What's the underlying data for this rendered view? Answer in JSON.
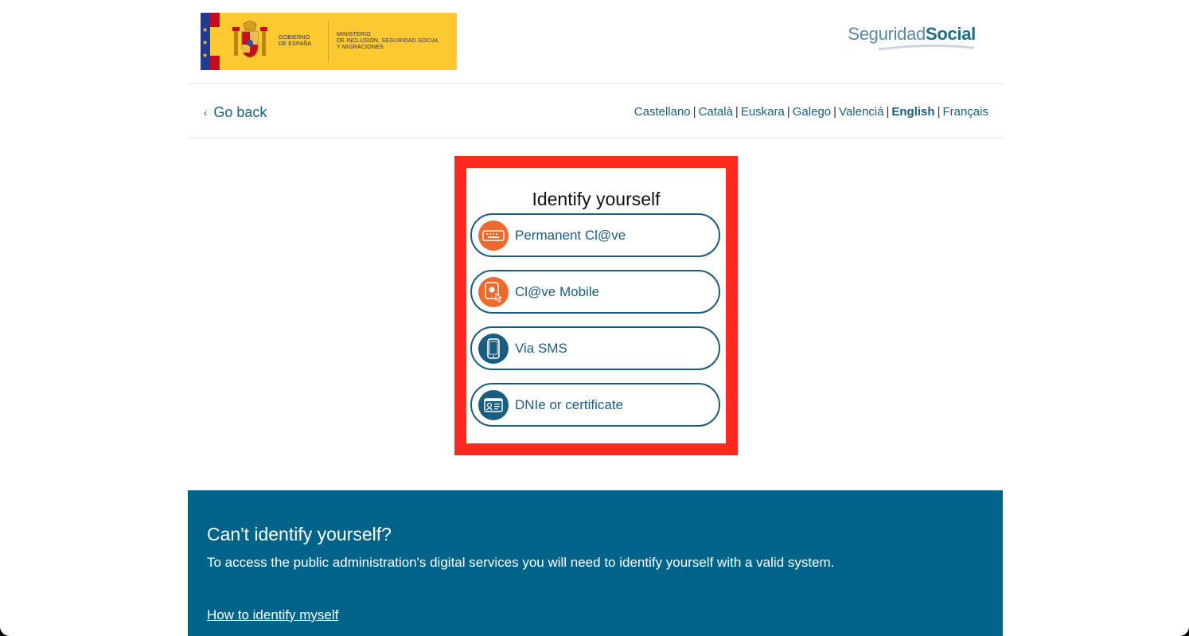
{
  "header": {
    "gov_logo": {
      "gobierno_line1": "GOBIERNO",
      "gobierno_line2": "DE ESPAÑA",
      "ministerio_line1": "MINISTERIO",
      "ministerio_line2": "DE INCLUSIÓN, SEGURIDAD SOCIAL",
      "ministerio_line3": "Y MIGRACIONES"
    },
    "ss_logo": {
      "part1": "Seguridad",
      "part2": "Social"
    }
  },
  "nav": {
    "go_back": "Go back",
    "languages": [
      {
        "label": "Castellano",
        "active": false
      },
      {
        "label": "Català",
        "active": false
      },
      {
        "label": "Euskara",
        "active": false
      },
      {
        "label": "Galego",
        "active": false
      },
      {
        "label": "Valenciá",
        "active": false
      },
      {
        "label": "English",
        "active": true
      },
      {
        "label": "Français",
        "active": false
      }
    ],
    "separator": "|"
  },
  "identify": {
    "title": "Identify yourself",
    "options": [
      {
        "label": "Permanent Cl@ve",
        "icon": "keyboard-icon"
      },
      {
        "label": "Cl@ve Mobile",
        "icon": "mobile-touch-icon"
      },
      {
        "label": "Via SMS",
        "icon": "smartphone-icon"
      },
      {
        "label": "DNIe or certificate",
        "icon": "id-card-icon"
      }
    ]
  },
  "help": {
    "title": "Can't identify yourself?",
    "text": "To access the public administration's digital services you will need to identify yourself with a valid system.",
    "link": "How to identify myself"
  },
  "colors": {
    "primary": "#1a5d7e",
    "orange": "#ee6a2c",
    "highlight": "#ff2a1e",
    "help_bg": "#00638a",
    "gov_yellow": "#fcc931"
  }
}
